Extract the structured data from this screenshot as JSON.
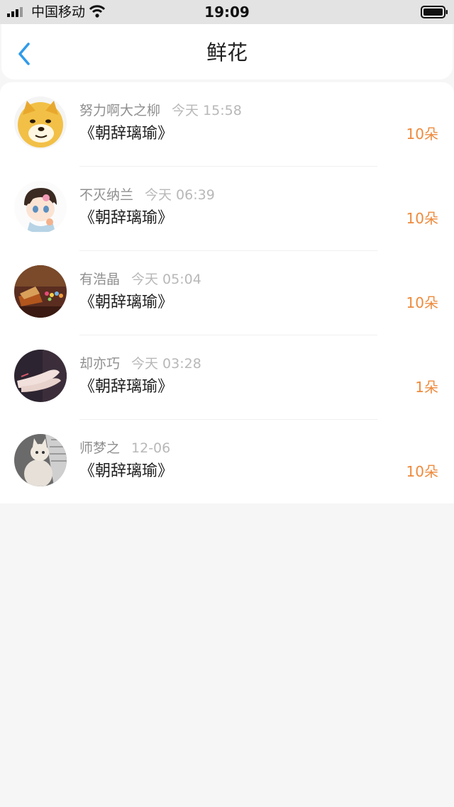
{
  "status_bar": {
    "carrier": "中国移动",
    "time": "19:09",
    "signal_icon": "signal-bars-icon",
    "wifi_icon": "wifi-icon",
    "battery_icon": "battery-icon"
  },
  "nav": {
    "title": "鲜花",
    "back_icon": "chevron-left-icon",
    "accent_color": "#2f9bea"
  },
  "list": {
    "count_color": "#ee8a3c",
    "items": [
      {
        "sender": "努力啊大之柳",
        "time": "今天 15:58",
        "book": "《朝辞璃瑜》",
        "count": "10朵",
        "avatar": "shiba-dog-avatar"
      },
      {
        "sender": "不灭纳兰",
        "time": "今天 06:39",
        "book": "《朝辞璃瑜》",
        "count": "10朵",
        "avatar": "cartoon-boy-avatar"
      },
      {
        "sender": "有浩晶",
        "time": "今天 05:04",
        "book": "《朝辞璃瑜》",
        "count": "10朵",
        "avatar": "bokeh-photo-avatar"
      },
      {
        "sender": "却亦巧",
        "time": "今天 03:28",
        "book": "《朝辞璃瑜》",
        "count": "1朵",
        "avatar": "hands-photo-avatar"
      },
      {
        "sender": "师梦之",
        "time": "12-06",
        "book": "《朝辞璃瑜》",
        "count": "10朵",
        "avatar": "cat-photo-avatar"
      }
    ]
  }
}
